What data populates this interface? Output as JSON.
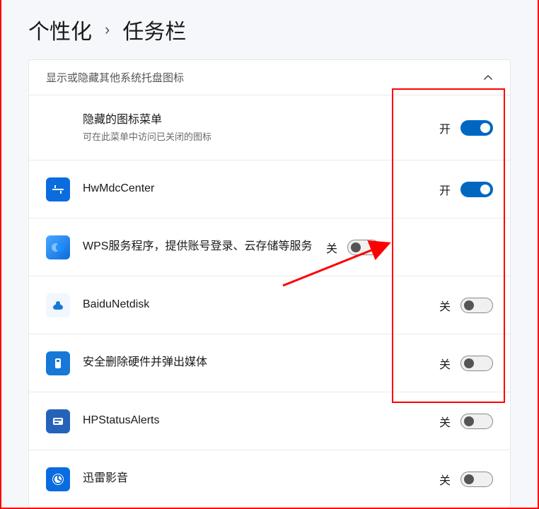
{
  "breadcrumb": {
    "parent": "个性化",
    "separator": "›",
    "current": "任务栏"
  },
  "section": {
    "header": "显示或隐藏其他系统托盘图标"
  },
  "state_labels": {
    "on": "开",
    "off": "关"
  },
  "items": [
    {
      "title": "隐藏的图标菜单",
      "subtitle": "可在此菜单中访问已关闭的图标",
      "state": "on",
      "has_icon": false
    },
    {
      "title": "HwMdcCenter",
      "state": "on",
      "has_icon": true,
      "icon": "hwmdc-icon"
    },
    {
      "title": "WPS服务程序，提供账号登录、云存储等服务",
      "state": "off",
      "has_icon": true,
      "icon": "wps-icon"
    },
    {
      "title": "BaiduNetdisk",
      "state": "off",
      "has_icon": true,
      "icon": "baidu-icon"
    },
    {
      "title": "安全删除硬件并弹出媒体",
      "state": "off",
      "has_icon": true,
      "icon": "usb-eject-icon"
    },
    {
      "title": "HPStatusAlerts",
      "state": "off",
      "has_icon": true,
      "icon": "hp-icon"
    },
    {
      "title": "迅雷影音",
      "state": "off",
      "has_icon": true,
      "icon": "xunlei-icon"
    }
  ]
}
